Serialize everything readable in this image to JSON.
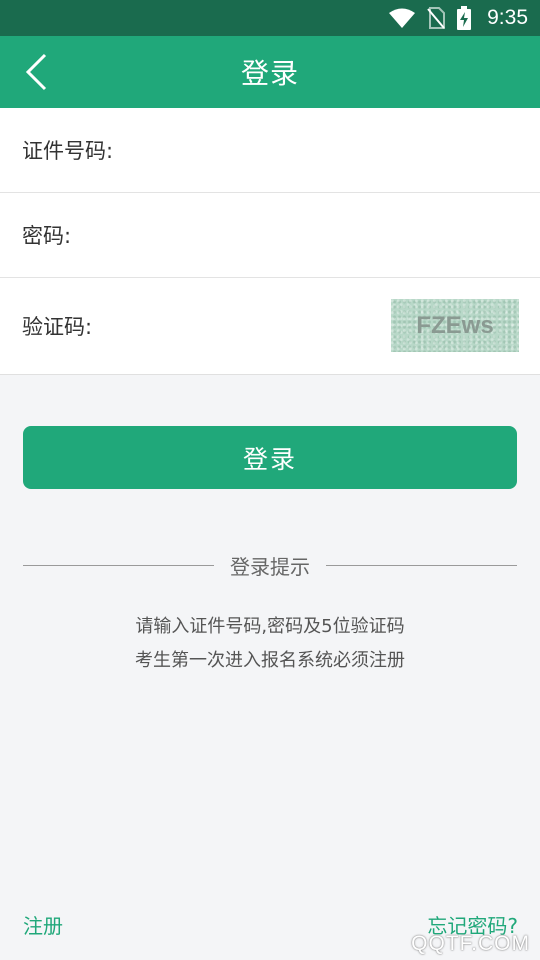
{
  "status_bar": {
    "time": "9:35",
    "icons": [
      "wifi-icon",
      "no-sim-icon",
      "battery-charging-icon"
    ]
  },
  "app_bar": {
    "title": "登录",
    "back_icon": "chevron-left-icon"
  },
  "form": {
    "id_label": "证件号码:",
    "id_value": "",
    "password_label": "密码:",
    "password_value": "",
    "captcha_label": "验证码:",
    "captcha_value": "",
    "captcha_image_text": "FZEws"
  },
  "login_button": "登录",
  "tips": {
    "title": "登录提示",
    "line1": "请输入证件号码,密码及5位验证码",
    "line2": "考生第一次进入报名系统必须注册"
  },
  "footer": {
    "register": "注册",
    "forgot_password": "忘记密码?",
    "watermark": "QQTF.COM"
  },
  "colors": {
    "primary": "#20a87a",
    "status_bar": "#1a6b4e",
    "background": "#f4f5f7"
  }
}
